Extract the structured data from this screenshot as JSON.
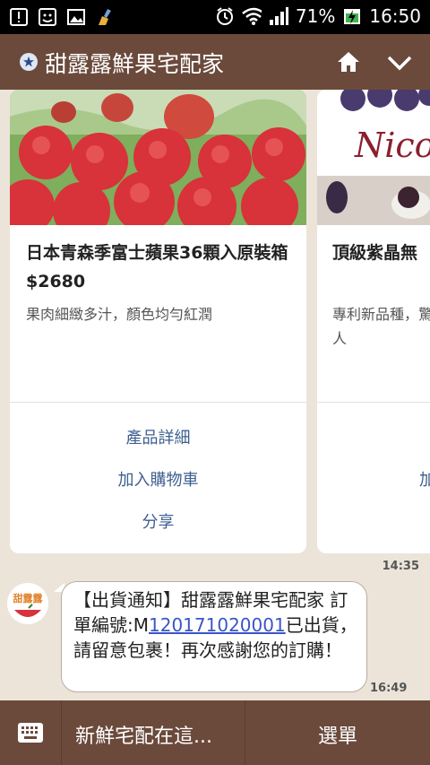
{
  "statusbar": {
    "battery_percent": "71%",
    "time": "16:50",
    "icons": [
      "alert-icon",
      "face-icon",
      "image-icon",
      "clean-icon",
      "alarm-icon",
      "wifi-icon",
      "signal-icon",
      "battery-charging-icon"
    ]
  },
  "header": {
    "title": "甜露露鮮果宅配家",
    "icons": [
      "star-badge-icon",
      "home-icon",
      "chevron-down-icon"
    ]
  },
  "cards": [
    {
      "title": "日本青森季富士蘋果36顆入原裝箱 $2680",
      "description": "果肉細緻多汁，顏色均勻紅潤",
      "actions": [
        "產品詳細",
        "加入購物車",
        "分享"
      ]
    },
    {
      "title": "頂級紫晶無",
      "description": "專利新品種，驚人",
      "image_text": "Nico",
      "actions": [
        "加"
      ]
    }
  ],
  "chat": {
    "time_1": "14:35",
    "avatar_text": "甜露露",
    "message_prefix": "【出貨通知】甜露露鮮果宅配家 訂單編號:M",
    "order_link": "120171020001",
    "message_suffix": "已出貨，請留意包裹！再次感謝您的訂購！",
    "time_2": "16:49"
  },
  "bottombar": {
    "input_label": "新鮮宅配在這...",
    "menu_label": "選單"
  },
  "colors": {
    "brand_brown": "#6b4a3c",
    "chat_bg": "#ece4d9",
    "action_blue": "#3d5f8f",
    "link_blue": "#3a55c8"
  }
}
